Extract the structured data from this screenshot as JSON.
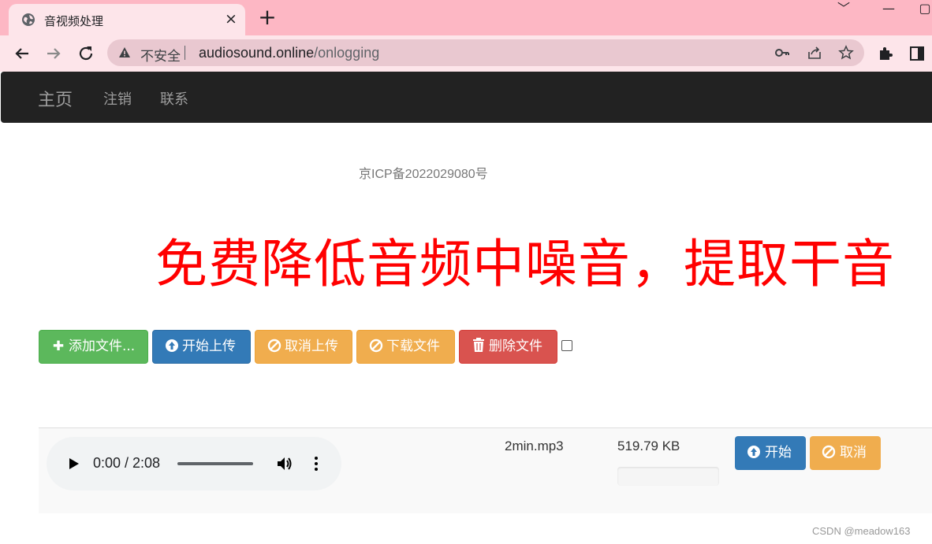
{
  "browser": {
    "tab_title": "音视频处理",
    "tab_close": "×",
    "new_tab": "+",
    "window_controls": [
      "﹀",
      "—",
      "▢"
    ],
    "insecure_label": "不安全",
    "url_host": "audiosound.online",
    "url_path": "/onlogging",
    "icons": [
      "back-arrow-icon",
      "forward-arrow-icon",
      "reload-icon",
      "warning-icon",
      "key-icon",
      "share-icon",
      "star-icon",
      "extensions-icon",
      "sidepanel-icon"
    ]
  },
  "navbar": {
    "brand": "主页",
    "links": [
      "注销",
      "联系"
    ]
  },
  "icp": "京ICP备2022029080号",
  "headline": "免费降低音频中噪音，提取干音",
  "actions": {
    "add": "添加文件...",
    "start_upload": "开始上传",
    "cancel_upload": "取消上传",
    "download": "下载文件",
    "delete": "删除文件"
  },
  "file": {
    "time": "0:00 / 2:08",
    "name": "2min.mp3",
    "size": "519.79 KB",
    "progress": 0,
    "start": "开始",
    "cancel": "取消"
  },
  "watermark": "CSDN @meadow163",
  "colors": {
    "tabstrip": "#fdb7c4",
    "headline": "#ff0000",
    "success": "#5cb85c",
    "primary": "#337ab7",
    "warning": "#f0ad4e",
    "danger": "#d9534f"
  }
}
